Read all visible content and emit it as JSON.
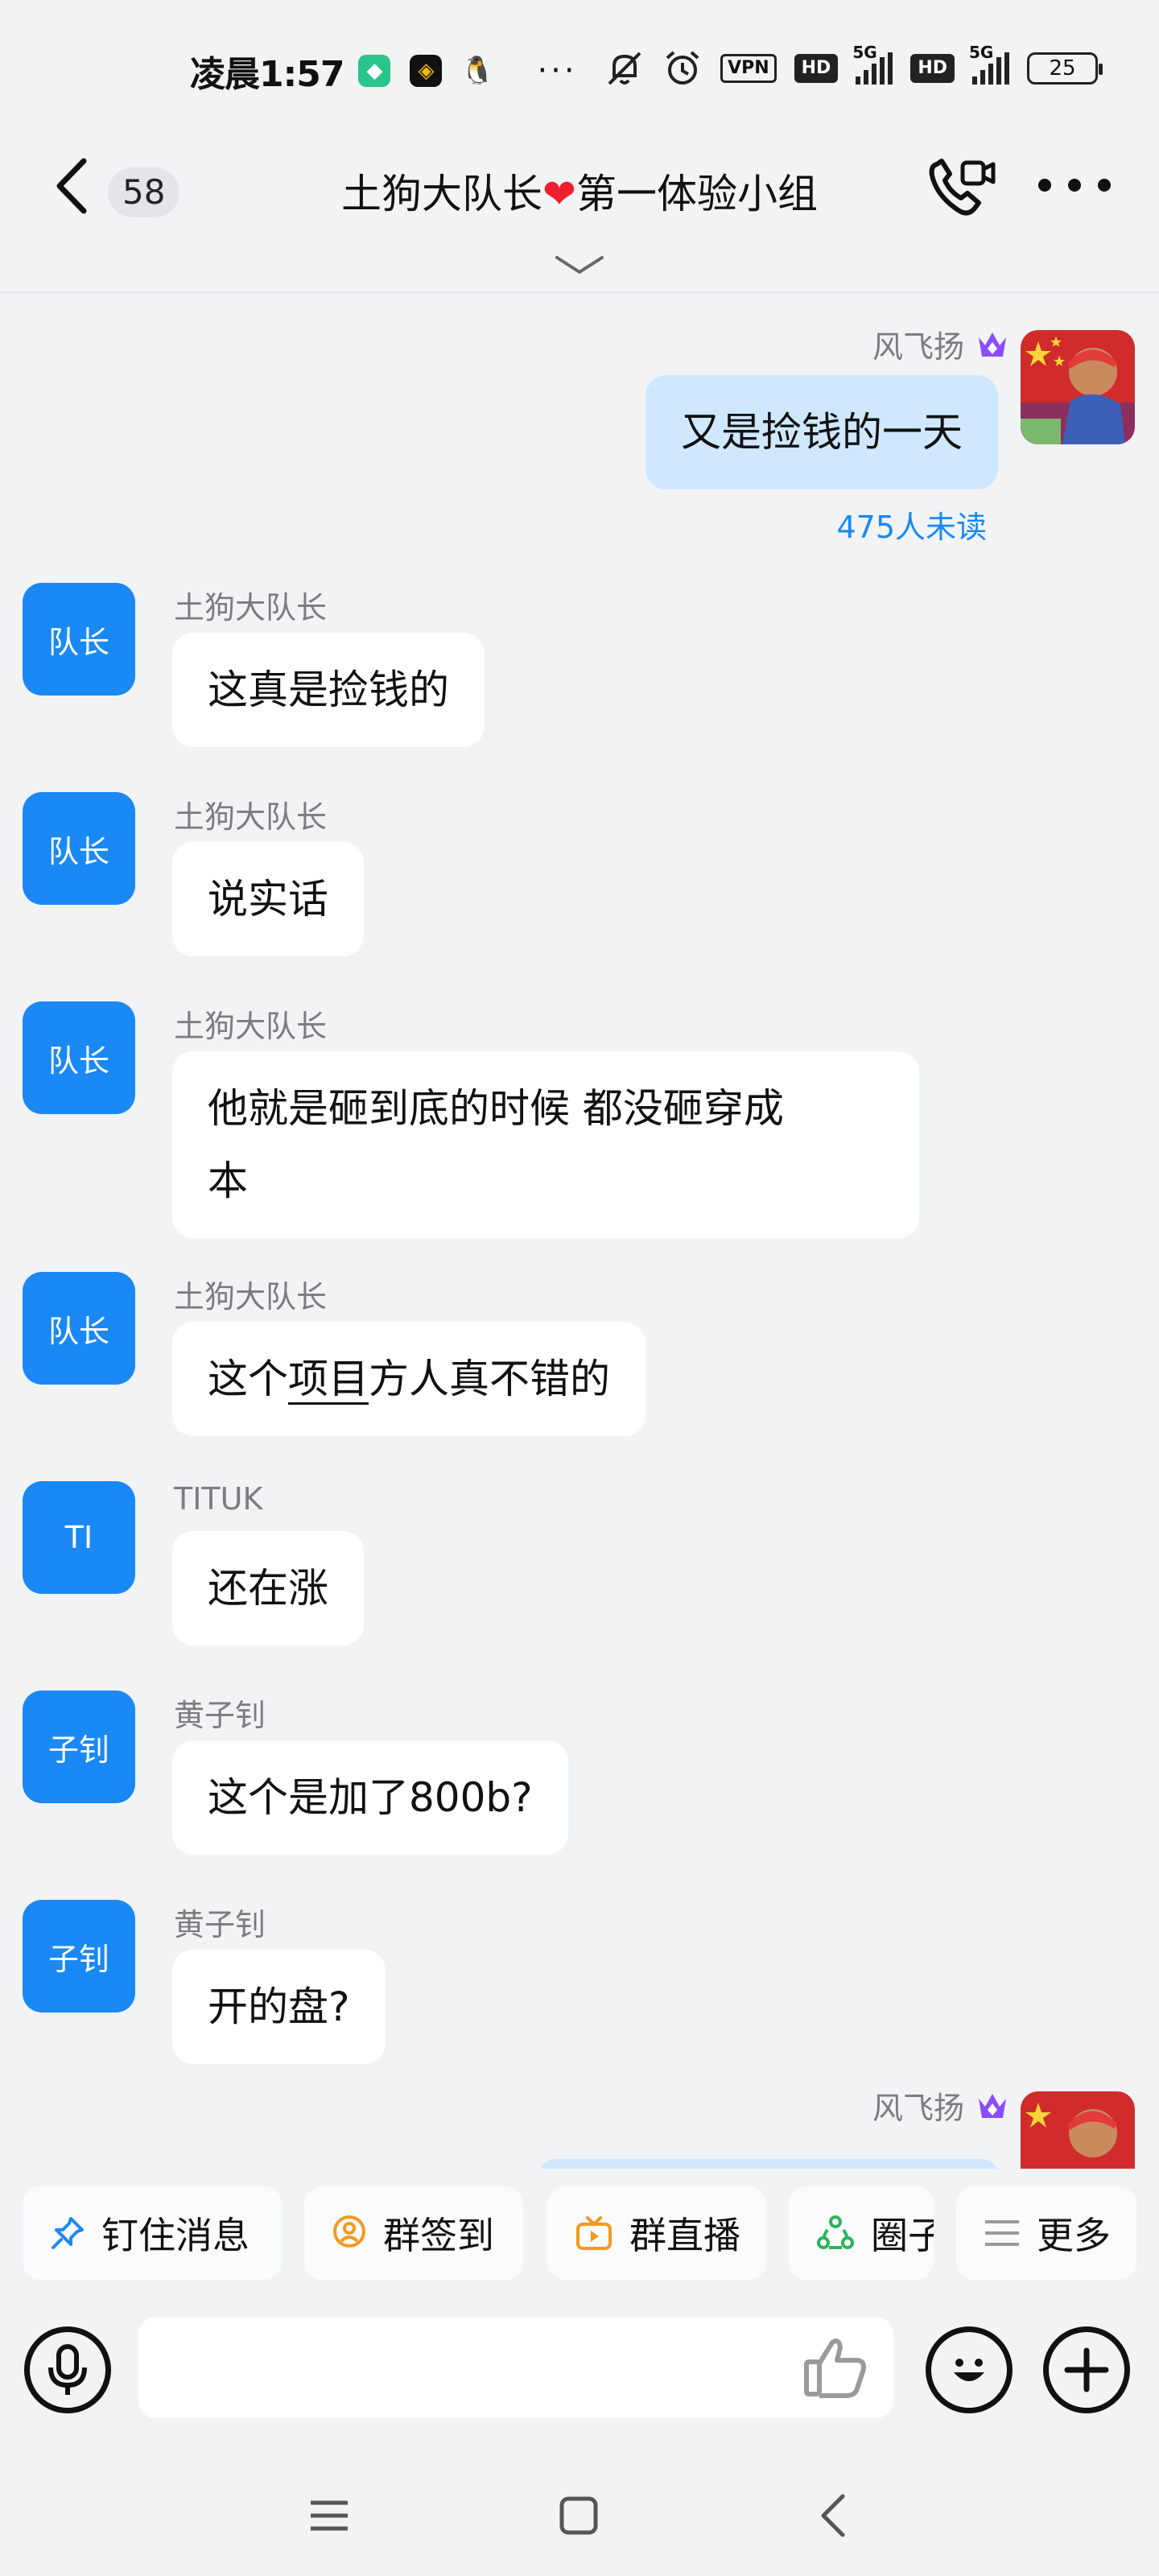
{
  "status_bar": {
    "time": "凌晨1:57",
    "more": "···",
    "vpn": "VPN",
    "hd1": "HD",
    "net1": "5G",
    "hd2": "HD",
    "net2": "5G",
    "battery": "25"
  },
  "header": {
    "unread_count": "58",
    "title_part1": "土狗大队长",
    "title_heart": "❤",
    "title_part2": "第一体验小组"
  },
  "messages": [
    {
      "sender": "风飞扬",
      "text": "又是捡钱的一天",
      "status": "475人未读"
    },
    {
      "avatar": "队长",
      "sender": "土狗大队长",
      "text": "这真是捡钱的"
    },
    {
      "avatar": "队长",
      "sender": "土狗大队长",
      "text": "说实话"
    },
    {
      "avatar": "队长",
      "sender": "土狗大队长",
      "line1": "他就是砸到底的时候 都没砸穿成",
      "line2": "本"
    },
    {
      "avatar": "队长",
      "sender": "土狗大队长",
      "pre": "这个",
      "link": "项目",
      "post": "方人真不错的"
    },
    {
      "avatar": "TI",
      "sender": "TITUK",
      "text": "还在涨"
    },
    {
      "avatar": "子钊",
      "sender": "黄子钊",
      "text": "这个是加了800b?"
    },
    {
      "avatar": "子钊",
      "sender": "黄子钊",
      "text": "开的盘?"
    },
    {
      "sender": "风飞扬"
    }
  ],
  "quick_actions": [
    {
      "label": "钉住消息",
      "icon": "pin-icon"
    },
    {
      "label": "群签到",
      "icon": "location-checkin-icon"
    },
    {
      "label": "群直播",
      "icon": "live-tv-icon"
    },
    {
      "label": "圈子",
      "icon": "circle-group-icon"
    },
    {
      "label": "更多",
      "icon": "menu-lines-icon"
    }
  ],
  "input": {
    "placeholder": ""
  },
  "colors": {
    "accent": "#1a89f5",
    "self_bubble": "#cfe8ff",
    "background": "#f2f3f5"
  }
}
